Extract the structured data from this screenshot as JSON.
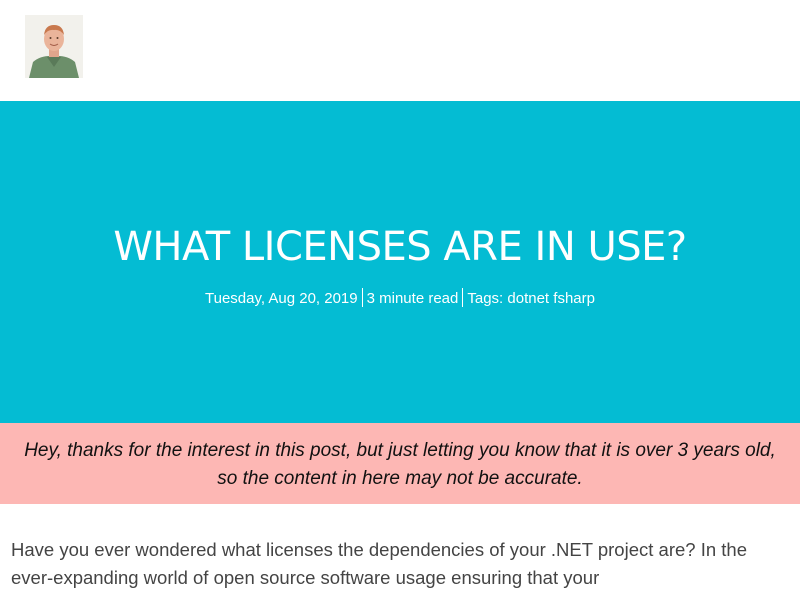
{
  "header": {
    "avatar_alt": "author avatar"
  },
  "post": {
    "title": "WHAT LICENSES ARE IN USE?",
    "date": "Tuesday, Aug 20, 2019",
    "read_time": "3 minute read",
    "tags_label": "Tags:",
    "tags": [
      "dotnet",
      "fsharp"
    ]
  },
  "notice": {
    "text": "Hey, thanks for the interest in this post, but just letting you know that it is over 3 years old, so the content in here may not be accurate."
  },
  "content": {
    "intro": "Have you ever wondered what licenses the dependencies of your .NET project are? In the ever-expanding world of open source software usage ensuring that your"
  },
  "colors": {
    "hero_bg": "#04bcd3",
    "notice_bg": "#fdb7b4",
    "body_text": "#444444"
  }
}
